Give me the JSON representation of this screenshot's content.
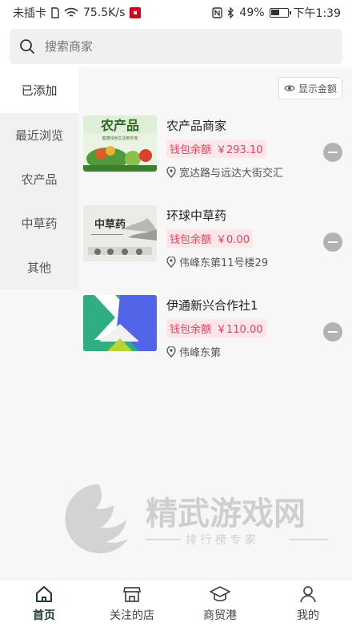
{
  "status_bar": {
    "carrier": "未插卡",
    "speed": "75.5K/s",
    "battery": "49%",
    "time": "下午1:39"
  },
  "search": {
    "placeholder": "搜索商家"
  },
  "categories": [
    {
      "label": "已添加",
      "active": true
    },
    {
      "label": "最近浏览"
    },
    {
      "label": "农产品"
    },
    {
      "label": "中草药"
    },
    {
      "label": "其他"
    }
  ],
  "show_amount_label": "显示金额",
  "merchants": [
    {
      "name": "农产品商家",
      "wallet_label": "钱包余额",
      "balance": "￥293.10",
      "address": "宽达路与远达大街交汇",
      "thumb_text": "农产品",
      "thumb_sub": "健康绿色生活到你家"
    },
    {
      "name": "环球中草药",
      "wallet_label": "钱包余额",
      "balance": "￥0.00",
      "address": "伟峰东第11号楼29",
      "thumb_text": "中草药"
    },
    {
      "name": "伊通新兴合作社1",
      "wallet_label": "钱包余额",
      "balance": "￥110.00",
      "address": "伟峰东第"
    }
  ],
  "watermark": {
    "title": "精武游戏网",
    "subtitle": "排 行 榜 专 家"
  },
  "tabs": [
    {
      "label": "首页",
      "icon": "home-icon",
      "active": true
    },
    {
      "label": "关注的店",
      "icon": "store-icon"
    },
    {
      "label": "商贸港",
      "icon": "graduation-cap-icon"
    },
    {
      "label": "我的",
      "icon": "user-icon"
    }
  ],
  "colors": {
    "accent": "#1f3b2a",
    "price": "#e8425a",
    "price_bg": "#fde7ea"
  }
}
